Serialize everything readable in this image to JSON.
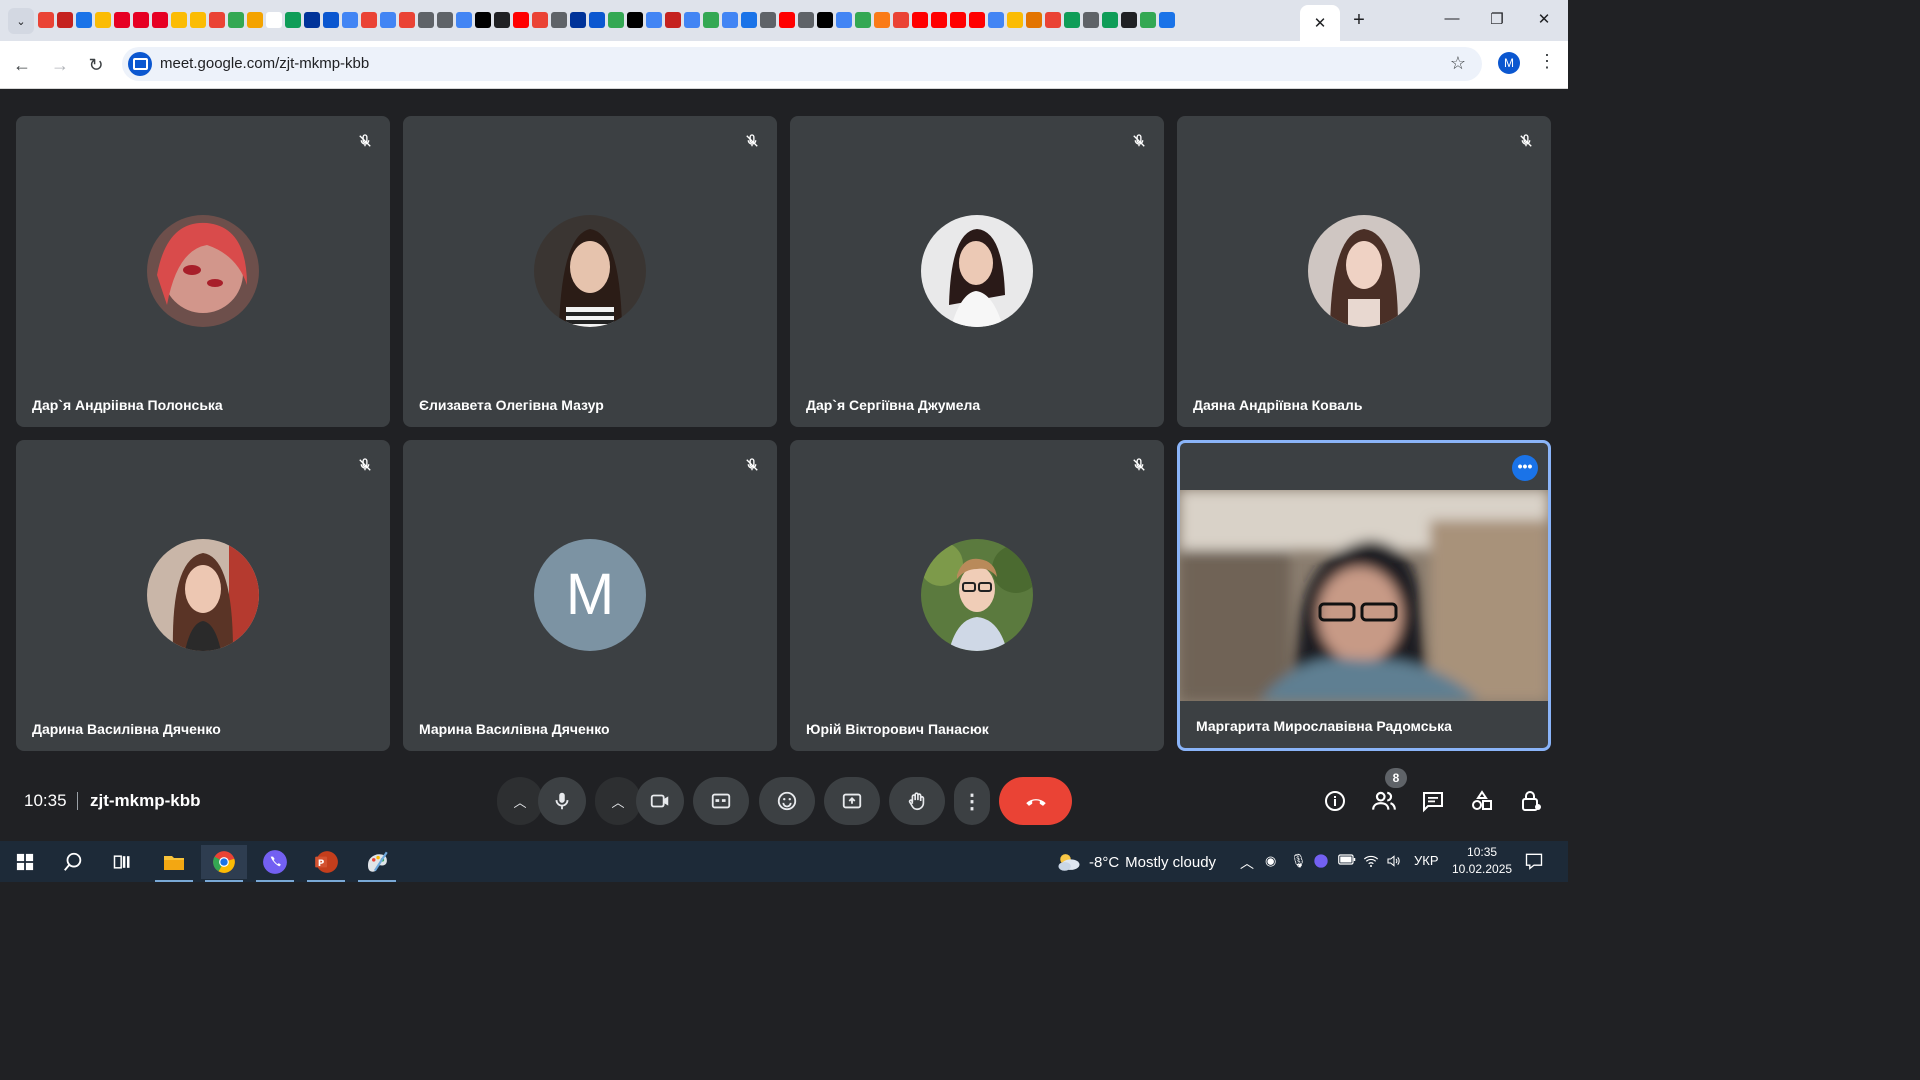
{
  "browser": {
    "tab_search_label": "⌄",
    "tab_close_label": "✕",
    "new_tab_label": "+",
    "window_controls": {
      "minimize": "—",
      "maximize": "❐",
      "close": "✕"
    },
    "url": "meet.google.com/zjt-mkmp-kbb",
    "profile_initial": "M",
    "favicon_colors": [
      "#ea4335",
      "#c5221f",
      "#1a73e8",
      "#fbbc04",
      "#e60023",
      "#e60023",
      "#e60023",
      "#fbbc04",
      "#fbbc04",
      "#ea4335",
      "#34a853",
      "#f4a300",
      "#ffffff",
      "#0f9d58",
      "#003399",
      "#0b57d0",
      "#4285f4",
      "#ea4335",
      "#4285f4",
      "#ea4335",
      "#5f6368",
      "#5f6368",
      "#4285f4",
      "#000000",
      "#202124",
      "#ff0000",
      "#ea4335",
      "#5f6368",
      "#003399",
      "#0b57d0",
      "#34a853",
      "#000000",
      "#4285f4",
      "#c5221f",
      "#4285f4",
      "#34a853",
      "#4285f4",
      "#1a73e8",
      "#5f6368",
      "#ff0000",
      "#5f6368",
      "#000000",
      "#4285f4",
      "#34a853",
      "#fa7b17",
      "#ea4335",
      "#ff0000",
      "#ff0000",
      "#ff0000",
      "#ff0000",
      "#4285f4",
      "#fbbc04",
      "#e37400",
      "#ea4335",
      "#0f9d58",
      "#5f6368",
      "#0f9d58",
      "#202124",
      "#34a853",
      "#1a73e8"
    ]
  },
  "meeting": {
    "time": "10:35",
    "code": "zjt-mkmp-kbb",
    "participants_count": "8",
    "more_options_label": "•••",
    "participants": [
      {
        "name": "Дар`я Андріівна Полонська",
        "muted": true,
        "avatar": "photo"
      },
      {
        "name": "Єлизавета Олегівна Мазур",
        "muted": true,
        "avatar": "photo"
      },
      {
        "name": "Дар`я Сергіївна Джумела",
        "muted": true,
        "avatar": "photo"
      },
      {
        "name": "Даяна Андріївна Коваль",
        "muted": true,
        "avatar": "photo"
      },
      {
        "name": "Дарина Василівна Дяченко",
        "muted": true,
        "avatar": "photo"
      },
      {
        "name": "Марина Василівна Дяченко",
        "muted": true,
        "avatar": "letter",
        "initial": "M"
      },
      {
        "name": "Юрій Вікторович Панасюк",
        "muted": true,
        "avatar": "photo"
      },
      {
        "name": "Маргарита Мирославівна Радомська",
        "muted": false,
        "avatar": "video"
      }
    ]
  },
  "taskbar": {
    "weather": {
      "temp": "-8°C",
      "desc": "Mostly cloudy"
    },
    "language": "УКР",
    "time": "10:35",
    "date": "10.02.2025"
  },
  "colors": {
    "meet_bg": "#202124",
    "tile_bg": "#3c4043",
    "end_call": "#ea4335",
    "accent": "#1a73e8",
    "active_border": "#8ab4f8"
  }
}
